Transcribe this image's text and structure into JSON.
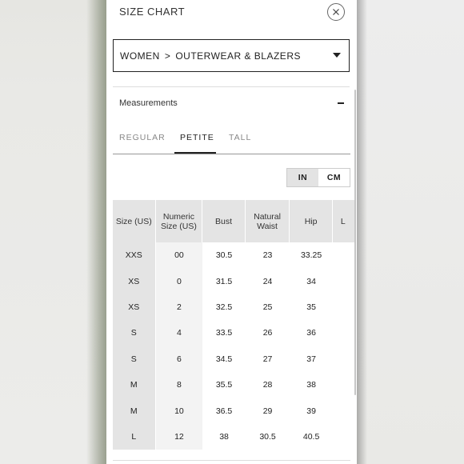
{
  "header": {
    "title": "SIZE CHART"
  },
  "category": {
    "part1": "WOMEN",
    "separator": ">",
    "part2": "OUTERWEAR & BLAZERS"
  },
  "measurements": {
    "label": "Measurements"
  },
  "tabs": [
    {
      "label": "REGULAR"
    },
    {
      "label": "PETITE"
    },
    {
      "label": "TALL"
    }
  ],
  "active_tab": "PETITE",
  "units": {
    "in": "IN",
    "cm": "CM",
    "selected": "IN"
  },
  "table": {
    "headers": [
      "Size (US)",
      "Numeric Size (US)",
      "Bust",
      "Natural Waist",
      "Hip",
      "L"
    ],
    "rows": [
      [
        "XXS",
        "00",
        "30.5",
        "23",
        "33.25"
      ],
      [
        "XS",
        "0",
        "31.5",
        "24",
        "34"
      ],
      [
        "XS",
        "2",
        "32.5",
        "25",
        "35"
      ],
      [
        "S",
        "4",
        "33.5",
        "26",
        "36"
      ],
      [
        "S",
        "6",
        "34.5",
        "27",
        "37"
      ],
      [
        "M",
        "8",
        "35.5",
        "28",
        "38"
      ],
      [
        "M",
        "10",
        "36.5",
        "29",
        "39"
      ],
      [
        "L",
        "12",
        "38",
        "30.5",
        "40.5"
      ]
    ]
  }
}
